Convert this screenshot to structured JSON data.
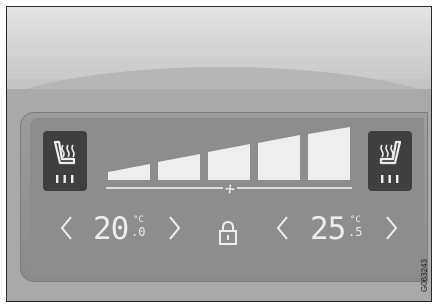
{
  "climate": {
    "left_zone": {
      "temperature": "20",
      "unit": "°C",
      "decimal": ".0",
      "decrease_label": "<",
      "increase_label": ">"
    },
    "right_zone": {
      "temperature": "25",
      "unit": "°C",
      "decimal": ".5",
      "decrease_label": "<",
      "increase_label": ">"
    },
    "fan": {
      "levels": 5,
      "icon": "fan-icon"
    },
    "lock_icon": "padlock-icon",
    "seat_heat_left_icon": "seat-heater-icon",
    "seat_heat_right_icon": "seat-heater-icon"
  },
  "figure_code": "G063243",
  "colors": {
    "display_glyph": "#ececec",
    "button_bg": "#3f3f3f",
    "panel_bg": "#8d8d8d"
  }
}
